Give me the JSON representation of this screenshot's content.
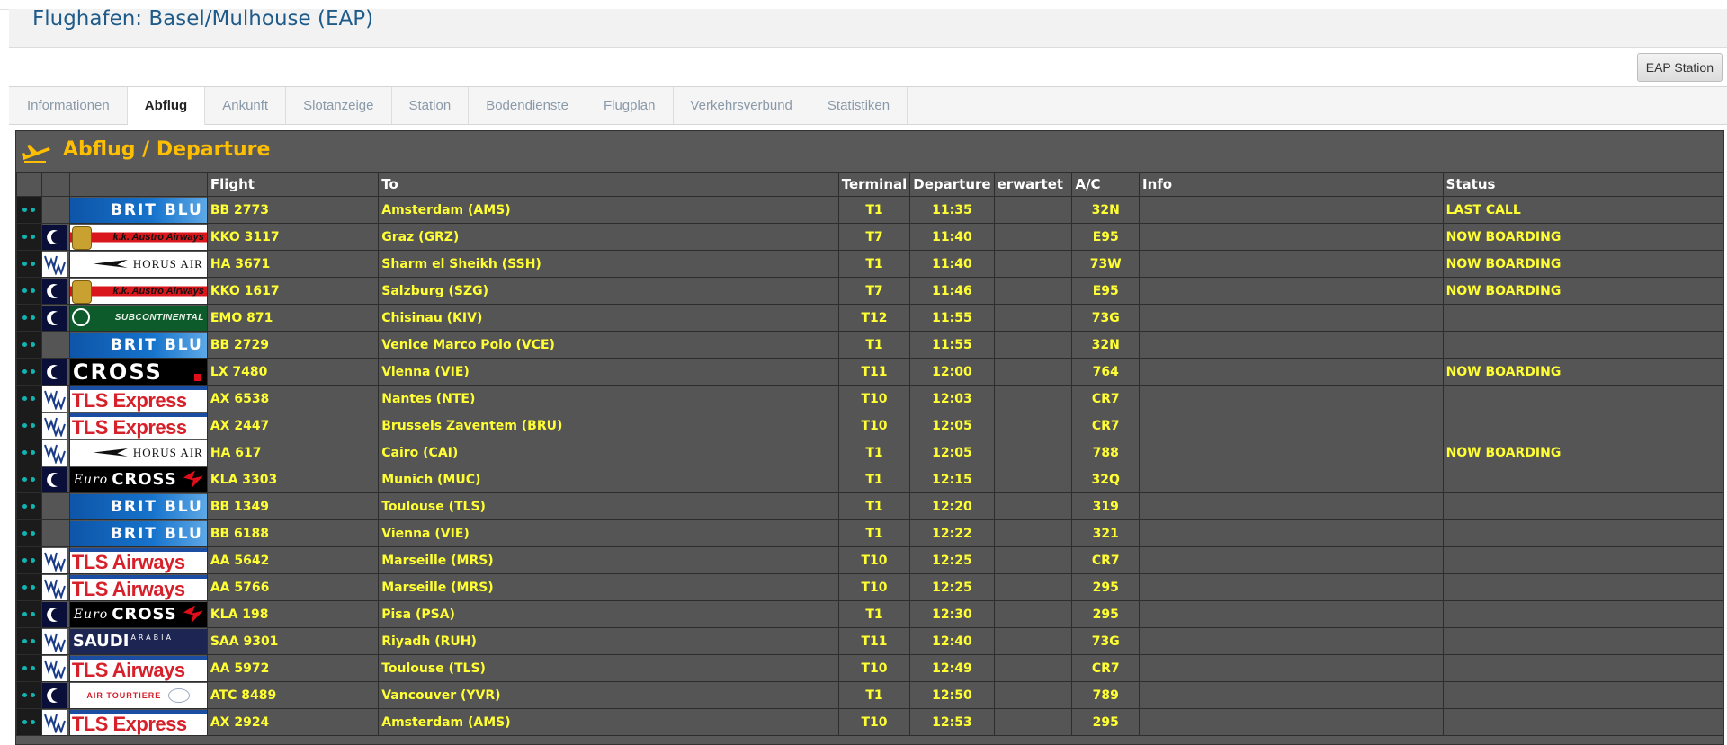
{
  "header": {
    "title": "Flughafen: Basel/Mulhouse (EAP)"
  },
  "toolbar": {
    "station_button": "EAP Station"
  },
  "tabs": [
    {
      "label": "Informationen"
    },
    {
      "label": "Abflug",
      "active": true
    },
    {
      "label": "Ankunft"
    },
    {
      "label": "Slotanzeige"
    },
    {
      "label": "Station"
    },
    {
      "label": "Bodendienste"
    },
    {
      "label": "Flugplan"
    },
    {
      "label": "Verkehrsverbund"
    },
    {
      "label": "Statistiken"
    }
  ],
  "board": {
    "title": "Abflug / Departure",
    "icon": "departure-plane-icon",
    "accent_color": "#ffbf00",
    "text_color": "#ffff33",
    "columns": {
      "flight": "Flight",
      "to": "To",
      "terminal": "Terminal",
      "departure": "Departure",
      "expected": "erwartet",
      "ac": "A/C",
      "info": "Info",
      "status": "Status"
    },
    "rows": [
      {
        "alliance": "",
        "airline": "BRIT BLU",
        "logo": "britblu",
        "flight": "BB 2773",
        "to": "Amsterdam (AMS)",
        "terminal": "T1",
        "departure": "11:35",
        "expected": "",
        "ac": "32N",
        "info": "",
        "status": "LAST CALL"
      },
      {
        "alliance": "c",
        "airline": "k.k. Austro Airways",
        "logo": "austro",
        "flight": "KKO 3117",
        "to": "Graz (GRZ)",
        "terminal": "T7",
        "departure": "11:40",
        "expected": "",
        "ac": "E95",
        "info": "",
        "status": "NOW BOARDING"
      },
      {
        "alliance": "ww",
        "airline": "HORUS AIR",
        "logo": "horus",
        "flight": "HA 3671",
        "to": "Sharm el Sheikh (SSH)",
        "terminal": "T1",
        "departure": "11:40",
        "expected": "",
        "ac": "73W",
        "info": "",
        "status": "NOW BOARDING"
      },
      {
        "alliance": "c",
        "airline": "k.k. Austro Airways",
        "logo": "austro",
        "flight": "KKO 1617",
        "to": "Salzburg (SZG)",
        "terminal": "T7",
        "departure": "11:46",
        "expected": "",
        "ac": "E95",
        "info": "",
        "status": "NOW BOARDING"
      },
      {
        "alliance": "c",
        "airline": "SUBCONTINENTAL",
        "logo": "subcon",
        "flight": "EMO 871",
        "to": "Chisinau (KIV)",
        "terminal": "T12",
        "departure": "11:55",
        "expected": "",
        "ac": "73G",
        "info": "",
        "status": ""
      },
      {
        "alliance": "",
        "airline": "BRIT BLU",
        "logo": "britblu",
        "flight": "BB 2729",
        "to": "Venice Marco Polo (VCE)",
        "terminal": "T1",
        "departure": "11:55",
        "expected": "",
        "ac": "32N",
        "info": "",
        "status": ""
      },
      {
        "alliance": "c",
        "airline": "CROSS",
        "logo": "cross",
        "flight": "LX 7480",
        "to": "Vienna (VIE)",
        "terminal": "T11",
        "departure": "12:00",
        "expected": "",
        "ac": "764",
        "info": "",
        "status": "NOW BOARDING"
      },
      {
        "alliance": "ww",
        "airline": "TLS Express",
        "logo": "tls",
        "flight": "AX 6538",
        "to": "Nantes (NTE)",
        "terminal": "T10",
        "departure": "12:03",
        "expected": "",
        "ac": "CR7",
        "info": "",
        "status": ""
      },
      {
        "alliance": "ww",
        "airline": "TLS Express",
        "logo": "tls",
        "flight": "AX 2447",
        "to": "Brussels Zaventem (BRU)",
        "terminal": "T10",
        "departure": "12:05",
        "expected": "",
        "ac": "CR7",
        "info": "",
        "status": ""
      },
      {
        "alliance": "ww",
        "airline": "HORUS AIR",
        "logo": "horus",
        "flight": "HA 617",
        "to": "Cairo (CAI)",
        "terminal": "T1",
        "departure": "12:05",
        "expected": "",
        "ac": "788",
        "info": "",
        "status": "NOW BOARDING"
      },
      {
        "alliance": "c",
        "airline": "CROSS",
        "airline_prefix": "Euro",
        "logo": "eurocross",
        "flight": "KLA 3303",
        "to": "Munich (MUC)",
        "terminal": "T1",
        "departure": "12:15",
        "expected": "",
        "ac": "32Q",
        "info": "",
        "status": ""
      },
      {
        "alliance": "",
        "airline": "BRIT BLU",
        "logo": "britblu",
        "flight": "BB 1349",
        "to": "Toulouse (TLS)",
        "terminal": "T1",
        "departure": "12:20",
        "expected": "",
        "ac": "319",
        "info": "",
        "status": ""
      },
      {
        "alliance": "",
        "airline": "BRIT BLU",
        "logo": "britblu",
        "flight": "BB 6188",
        "to": "Vienna (VIE)",
        "terminal": "T1",
        "departure": "12:22",
        "expected": "",
        "ac": "321",
        "info": "",
        "status": ""
      },
      {
        "alliance": "ww",
        "airline": "TLS Airways",
        "logo": "tls",
        "flight": "AA 5642",
        "to": "Marseille (MRS)",
        "terminal": "T10",
        "departure": "12:25",
        "expected": "",
        "ac": "CR7",
        "info": "",
        "status": ""
      },
      {
        "alliance": "ww",
        "airline": "TLS Airways",
        "logo": "tls",
        "flight": "AA 5766",
        "to": "Marseille (MRS)",
        "terminal": "T10",
        "departure": "12:25",
        "expected": "",
        "ac": "295",
        "info": "",
        "status": ""
      },
      {
        "alliance": "c",
        "airline": "CROSS",
        "airline_prefix": "Euro",
        "logo": "eurocross",
        "flight": "KLA 198",
        "to": "Pisa (PSA)",
        "terminal": "T1",
        "departure": "12:30",
        "expected": "",
        "ac": "295",
        "info": "",
        "status": ""
      },
      {
        "alliance": "ww",
        "airline": "SAUDI",
        "airline_suffix": "ARABIA",
        "logo": "saudi",
        "flight": "SAA 9301",
        "to": "Riyadh (RUH)",
        "terminal": "T11",
        "departure": "12:40",
        "expected": "",
        "ac": "73G",
        "info": "",
        "status": ""
      },
      {
        "alliance": "ww",
        "airline": "TLS Airways",
        "logo": "tls",
        "flight": "AA 5972",
        "to": "Toulouse (TLS)",
        "terminal": "T10",
        "departure": "12:49",
        "expected": "",
        "ac": "CR7",
        "info": "",
        "status": ""
      },
      {
        "alliance": "c",
        "airline": "AIR TOURTIERE",
        "logo": "tourt",
        "flight": "ATC 8489",
        "to": "Vancouver (YVR)",
        "terminal": "T1",
        "departure": "12:50",
        "expected": "",
        "ac": "789",
        "info": "",
        "status": ""
      },
      {
        "alliance": "ww",
        "airline": "TLS Express",
        "logo": "tls",
        "flight": "AX 2924",
        "to": "Amsterdam (AMS)",
        "terminal": "T10",
        "departure": "12:53",
        "expected": "",
        "ac": "295",
        "info": "",
        "status": ""
      }
    ]
  }
}
